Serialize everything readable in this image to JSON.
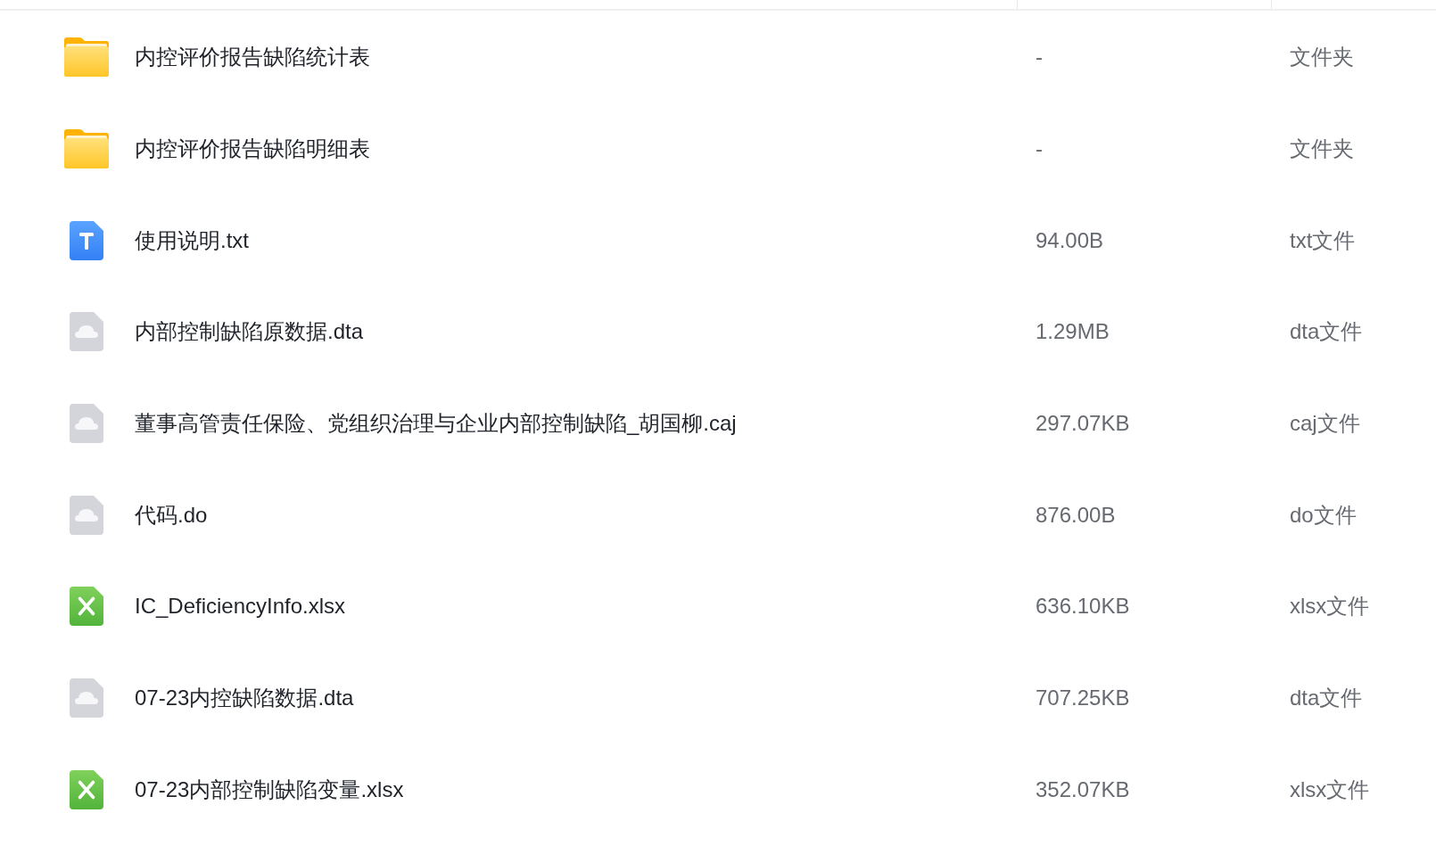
{
  "files": [
    {
      "kind": "folder",
      "name": "内控评价报告缺陷统计表",
      "size": "-",
      "type": "文件夹"
    },
    {
      "kind": "folder",
      "name": "内控评价报告缺陷明细表",
      "size": "-",
      "type": "文件夹"
    },
    {
      "kind": "text",
      "name": "使用说明.txt",
      "size": "94.00B",
      "type": "txt文件"
    },
    {
      "kind": "generic",
      "name": "内部控制缺陷原数据.dta",
      "size": "1.29MB",
      "type": "dta文件"
    },
    {
      "kind": "generic",
      "name": "董事高管责任保险、党组织治理与企业内部控制缺陷_胡国柳.caj",
      "size": "297.07KB",
      "type": "caj文件"
    },
    {
      "kind": "generic",
      "name": "代码.do",
      "size": "876.00B",
      "type": "do文件"
    },
    {
      "kind": "spreadsheet",
      "name": "IC_DeficiencyInfo.xlsx",
      "size": "636.10KB",
      "type": "xlsx文件"
    },
    {
      "kind": "generic",
      "name": "07-23内控缺陷数据.dta",
      "size": "707.25KB",
      "type": "dta文件"
    },
    {
      "kind": "spreadsheet",
      "name": "07-23内部控制缺陷变量.xlsx",
      "size": "352.07KB",
      "type": "xlsx文件"
    }
  ]
}
